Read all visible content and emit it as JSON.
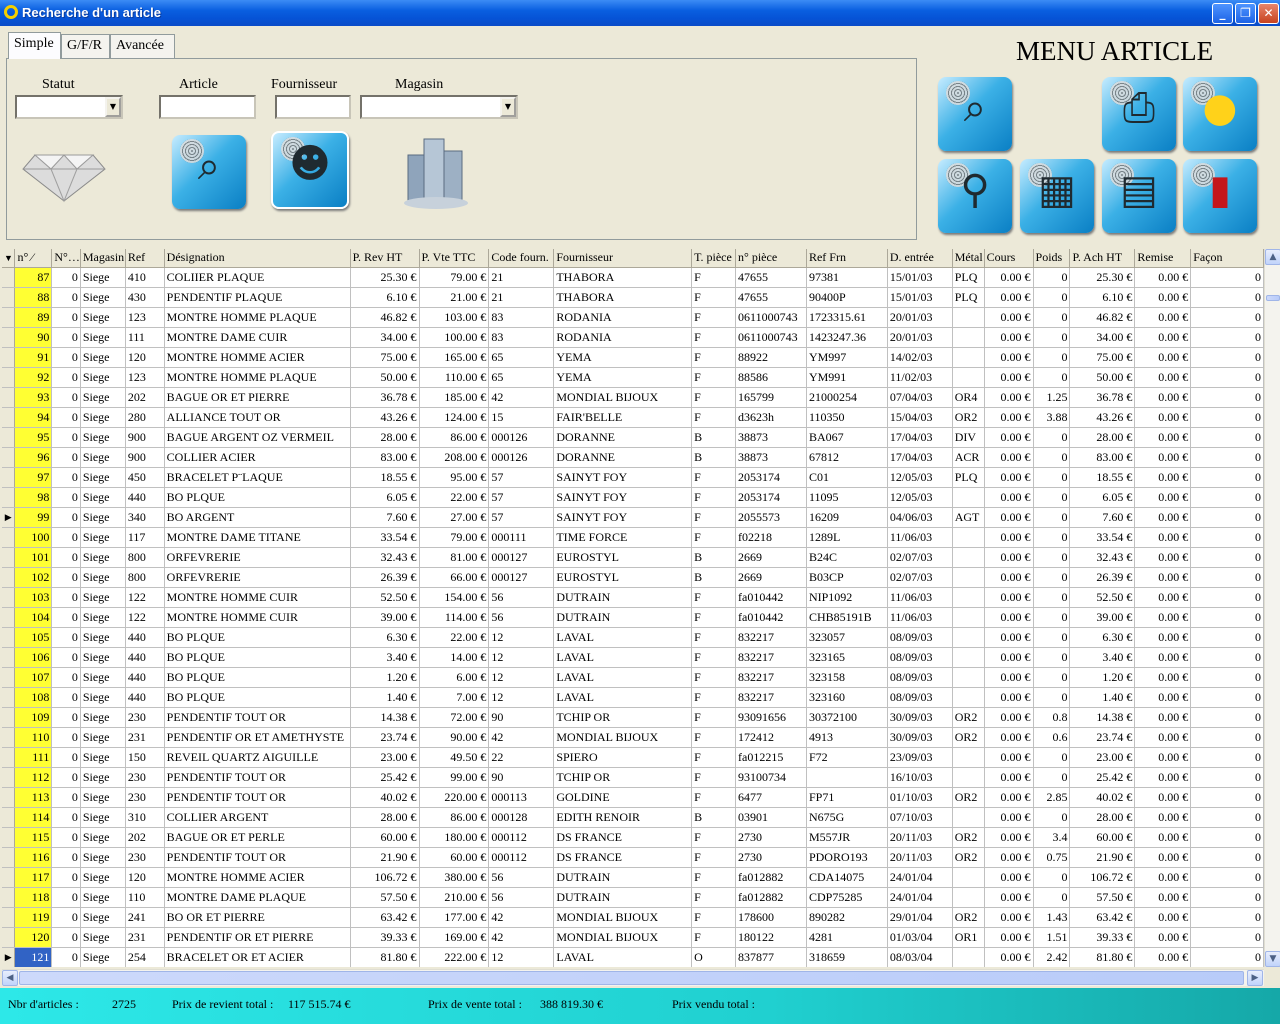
{
  "window": {
    "title": "Recherche d'un article"
  },
  "tabs": [
    "Simple",
    "G/F/R",
    "Avancée"
  ],
  "filters": {
    "statut_label": "Statut",
    "article_label": "Article",
    "fournisseur_label": "Fournisseur",
    "magasin_label": "Magasin",
    "statut_value": "",
    "article_value": "",
    "fournisseur_value": "",
    "magasin_value": ""
  },
  "menu": {
    "title": "MENU ARTICLE"
  },
  "icons": {
    "search": "binoculars-icon",
    "search_person": "person-binoculars-icon",
    "buildings": "buildings-icon",
    "diamond": "diamond-icon",
    "print": "printer-icon",
    "idea": "lightbulb-icon",
    "zoom": "magnifier-icon",
    "trash": "trash-icon",
    "calculator": "calculator-icon",
    "exit": "door-icon"
  },
  "grid": {
    "columns": [
      "n° ⁄",
      "N°…",
      "Magasin",
      "Ref",
      "Désignation",
      "P. Rev HT",
      "P. Vte TTC",
      "Code fourn.",
      "Fournisseur",
      "T. pièce",
      "n° pièce",
      "Ref Frn",
      "D. entrée",
      "Métal",
      "Cours",
      "Poids",
      "P. Ach HT",
      "Remise",
      "Façon"
    ],
    "rows": [
      [
        "87",
        "0",
        "Siege",
        "410",
        "COLIIER PLAQUE",
        "25.30 €",
        "79.00 €",
        "21",
        "THABORA",
        "F",
        "47655",
        "97381",
        "15/01/03",
        "PLQ",
        "0.00 €",
        "0",
        "25.30 €",
        "0.00 €",
        "0"
      ],
      [
        "88",
        "0",
        "Siege",
        "430",
        "PENDENTIF PLAQUE",
        "6.10 €",
        "21.00 €",
        "21",
        "THABORA",
        "F",
        "47655",
        "90400P",
        "15/01/03",
        "PLQ",
        "0.00 €",
        "0",
        "6.10 €",
        "0.00 €",
        "0"
      ],
      [
        "89",
        "0",
        "Siege",
        "123",
        "MONTRE HOMME PLAQUE",
        "46.82 €",
        "103.00 €",
        "83",
        "RODANIA",
        "F",
        "0611000743",
        "1723315.61",
        "20/01/03",
        "",
        "0.00 €",
        "0",
        "46.82 €",
        "0.00 €",
        "0"
      ],
      [
        "90",
        "0",
        "Siege",
        "111",
        "MONTRE DAME CUIR",
        "34.00 €",
        "100.00 €",
        "83",
        "RODANIA",
        "F",
        "0611000743",
        "1423247.36",
        "20/01/03",
        "",
        "0.00 €",
        "0",
        "34.00 €",
        "0.00 €",
        "0"
      ],
      [
        "91",
        "0",
        "Siege",
        "120",
        "MONTRE HOMME ACIER",
        "75.00 €",
        "165.00 €",
        "65",
        "YEMA",
        "F",
        "88922",
        "YM997",
        "14/02/03",
        "",
        "0.00 €",
        "0",
        "75.00 €",
        "0.00 €",
        "0"
      ],
      [
        "92",
        "0",
        "Siege",
        "123",
        "MONTRE HOMME PLAQUE",
        "50.00 €",
        "110.00 €",
        "65",
        "YEMA",
        "F",
        "88586",
        "YM991",
        "11/02/03",
        "",
        "0.00 €",
        "0",
        "50.00 €",
        "0.00 €",
        "0"
      ],
      [
        "93",
        "0",
        "Siege",
        "202",
        "BAGUE OR ET PIERRE",
        "36.78 €",
        "185.00 €",
        "42",
        "MONDIAL BIJOUX",
        "F",
        "165799",
        "21000254",
        "07/04/03",
        "OR4",
        "0.00 €",
        "1.25",
        "36.78 €",
        "0.00 €",
        "0"
      ],
      [
        "94",
        "0",
        "Siege",
        "280",
        "ALLIANCE TOUT OR",
        "43.26 €",
        "124.00 €",
        "15",
        "FAIR'BELLE",
        "F",
        "d3623h",
        "110350",
        "15/04/03",
        "OR2",
        "0.00 €",
        "3.88",
        "43.26 €",
        "0.00 €",
        "0"
      ],
      [
        "95",
        "0",
        "Siege",
        "900",
        "BAGUE ARGENT OZ VERMEIL",
        "28.00 €",
        "86.00 €",
        "000126",
        "DORANNE",
        "B",
        "38873",
        "BA067",
        "17/04/03",
        "DIV",
        "0.00 €",
        "0",
        "28.00 €",
        "0.00 €",
        "0"
      ],
      [
        "96",
        "0",
        "Siege",
        "900",
        "COLLIER ACIER",
        "83.00 €",
        "208.00 €",
        "000126",
        "DORANNE",
        "B",
        "38873",
        "67812",
        "17/04/03",
        "ACR",
        "0.00 €",
        "0",
        "83.00 €",
        "0.00 €",
        "0"
      ],
      [
        "97",
        "0",
        "Siege",
        "450",
        "BRACELET P¨LAQUE",
        "18.55 €",
        "95.00 €",
        "57",
        "SAINYT FOY",
        "F",
        "2053174",
        "C01",
        "12/05/03",
        "PLQ",
        "0.00 €",
        "0",
        "18.55 €",
        "0.00 €",
        "0"
      ],
      [
        "98",
        "0",
        "Siege",
        "440",
        "BO PLQUE",
        "6.05 €",
        "22.00 €",
        "57",
        "SAINYT FOY",
        "F",
        "2053174",
        "11095",
        "12/05/03",
        "",
        "0.00 €",
        "0",
        "6.05 €",
        "0.00 €",
        "0"
      ],
      [
        "99",
        "0",
        "Siege",
        "340",
        "BO ARGENT",
        "7.60 €",
        "27.00 €",
        "57",
        "SAINYT FOY",
        "F",
        "2055573",
        "16209",
        "04/06/03",
        "AGT",
        "0.00 €",
        "0",
        "7.60 €",
        "0.00 €",
        "0"
      ],
      [
        "100",
        "0",
        "Siege",
        "117",
        "MONTRE DAME TITANE",
        "33.54 €",
        "79.00 €",
        "000111",
        "TIME FORCE",
        "F",
        "f02218",
        "1289L",
        "11/06/03",
        "",
        "0.00 €",
        "0",
        "33.54 €",
        "0.00 €",
        "0"
      ],
      [
        "101",
        "0",
        "Siege",
        "800",
        "ORFEVRERIE",
        "32.43 €",
        "81.00 €",
        "000127",
        "EUROSTYL",
        "B",
        "2669",
        "B24C",
        "02/07/03",
        "",
        "0.00 €",
        "0",
        "32.43 €",
        "0.00 €",
        "0"
      ],
      [
        "102",
        "0",
        "Siege",
        "800",
        "ORFEVRERIE",
        "26.39 €",
        "66.00 €",
        "000127",
        "EUROSTYL",
        "B",
        "2669",
        "B03CP",
        "02/07/03",
        "",
        "0.00 €",
        "0",
        "26.39 €",
        "0.00 €",
        "0"
      ],
      [
        "103",
        "0",
        "Siege",
        "122",
        "MONTRE HOMME CUIR",
        "52.50 €",
        "154.00 €",
        "56",
        "DUTRAIN",
        "F",
        "fa010442",
        "NIP1092",
        "11/06/03",
        "",
        "0.00 €",
        "0",
        "52.50 €",
        "0.00 €",
        "0"
      ],
      [
        "104",
        "0",
        "Siege",
        "122",
        "MONTRE HOMME CUIR",
        "39.00 €",
        "114.00 €",
        "56",
        "DUTRAIN",
        "F",
        "fa010442",
        "CHB85191B",
        "11/06/03",
        "",
        "0.00 €",
        "0",
        "39.00 €",
        "0.00 €",
        "0"
      ],
      [
        "105",
        "0",
        "Siege",
        "440",
        "BO PLQUE",
        "6.30 €",
        "22.00 €",
        "12",
        "LAVAL",
        "F",
        "832217",
        "323057",
        "08/09/03",
        "",
        "0.00 €",
        "0",
        "6.30 €",
        "0.00 €",
        "0"
      ],
      [
        "106",
        "0",
        "Siege",
        "440",
        "BO PLQUE",
        "3.40 €",
        "14.00 €",
        "12",
        "LAVAL",
        "F",
        "832217",
        "323165",
        "08/09/03",
        "",
        "0.00 €",
        "0",
        "3.40 €",
        "0.00 €",
        "0"
      ],
      [
        "107",
        "0",
        "Siege",
        "440",
        "BO PLQUE",
        "1.20 €",
        "6.00 €",
        "12",
        "LAVAL",
        "F",
        "832217",
        "323158",
        "08/09/03",
        "",
        "0.00 €",
        "0",
        "1.20 €",
        "0.00 €",
        "0"
      ],
      [
        "108",
        "0",
        "Siege",
        "440",
        "BO PLQUE",
        "1.40 €",
        "7.00 €",
        "12",
        "LAVAL",
        "F",
        "832217",
        "323160",
        "08/09/03",
        "",
        "0.00 €",
        "0",
        "1.40 €",
        "0.00 €",
        "0"
      ],
      [
        "109",
        "0",
        "Siege",
        "230",
        "PENDENTIF  TOUT OR",
        "14.38 €",
        "72.00 €",
        "90",
        "TCHIP OR",
        "F",
        "93091656",
        "30372100",
        "30/09/03",
        "OR2",
        "0.00 €",
        "0.8",
        "14.38 €",
        "0.00 €",
        "0"
      ],
      [
        "110",
        "0",
        "Siege",
        "231",
        "PENDENTIF OR ET AMETHYSTE",
        "23.74 €",
        "90.00 €",
        "42",
        "MONDIAL BIJOUX",
        "F",
        "172412",
        "4913",
        "30/09/03",
        "OR2",
        "0.00 €",
        "0.6",
        "23.74 €",
        "0.00 €",
        "0"
      ],
      [
        "111",
        "0",
        "Siege",
        "150",
        "REVEIL QUARTZ AIGUILLE",
        "23.00 €",
        "49.50 €",
        "22",
        "SPIERO",
        "F",
        "fa012215",
        "F72",
        "23/09/03",
        "",
        "0.00 €",
        "0",
        "23.00 €",
        "0.00 €",
        "0"
      ],
      [
        "112",
        "0",
        "Siege",
        "230",
        "PENDENTIF  TOUT OR",
        "25.42 €",
        "99.00 €",
        "90",
        "TCHIP OR",
        "F",
        "93100734",
        "",
        "16/10/03",
        "",
        "0.00 €",
        "0",
        "25.42 €",
        "0.00 €",
        "0"
      ],
      [
        "113",
        "0",
        "Siege",
        "230",
        "PENDENTIF  TOUT OR",
        "40.02 €",
        "220.00 €",
        "000113",
        "GOLDINE",
        "F",
        "6477",
        "FP71",
        "01/10/03",
        "OR2",
        "0.00 €",
        "2.85",
        "40.02 €",
        "0.00 €",
        "0"
      ],
      [
        "114",
        "0",
        "Siege",
        "310",
        "COLLIER ARGENT",
        "28.00 €",
        "86.00 €",
        "000128",
        "EDITH RENOIR",
        "B",
        "03901",
        "N675G",
        "07/10/03",
        "",
        "0.00 €",
        "0",
        "28.00 €",
        "0.00 €",
        "0"
      ],
      [
        "115",
        "0",
        "Siege",
        "202",
        "BAGUE OR ET PERLE",
        "60.00 €",
        "180.00 €",
        "000112",
        "DS FRANCE",
        "F",
        "2730",
        "M557JR",
        "20/11/03",
        "OR2",
        "0.00 €",
        "3.4",
        "60.00 €",
        "0.00 €",
        "0"
      ],
      [
        "116",
        "0",
        "Siege",
        "230",
        "PENDENTIF  TOUT OR",
        "21.90 €",
        "60.00 €",
        "000112",
        "DS FRANCE",
        "F",
        "2730",
        "PDORO193",
        "20/11/03",
        "OR2",
        "0.00 €",
        "0.75",
        "21.90 €",
        "0.00 €",
        "0"
      ],
      [
        "117",
        "0",
        "Siege",
        "120",
        "MONTRE HOMME ACIER",
        "106.72 €",
        "380.00 €",
        "56",
        "DUTRAIN",
        "F",
        "fa012882",
        "CDA14075",
        "24/01/04",
        "",
        "0.00 €",
        "0",
        "106.72 €",
        "0.00 €",
        "0"
      ],
      [
        "118",
        "0",
        "Siege",
        "110",
        "MONTRE DAME PLAQUE",
        "57.50 €",
        "210.00 €",
        "56",
        "DUTRAIN",
        "F",
        "fa012882",
        "CDP75285",
        "24/01/04",
        "",
        "0.00 €",
        "0",
        "57.50 €",
        "0.00 €",
        "0"
      ],
      [
        "119",
        "0",
        "Siege",
        "241",
        "BO OR ET PIERRE",
        "63.42 €",
        "177.00 €",
        "42",
        "MONDIAL BIJOUX",
        "F",
        "178600",
        "890282",
        "29/01/04",
        "OR2",
        "0.00 €",
        "1.43",
        "63.42 €",
        "0.00 €",
        "0"
      ],
      [
        "120",
        "0",
        "Siege",
        "231",
        "PENDENTIF OR ET PIERRE",
        "39.33 €",
        "169.00 €",
        "42",
        "MONDIAL BIJOUX",
        "F",
        "180122",
        "4281",
        "01/03/04",
        "OR1",
        "0.00 €",
        "1.51",
        "39.33 €",
        "0.00 €",
        "0"
      ],
      [
        "121",
        "0",
        "Siege",
        "254",
        "BRACELET OR ET ACIER",
        "81.80 €",
        "222.00 €",
        "12",
        "LAVAL",
        "O",
        "837877",
        "318659",
        "08/03/04",
        "",
        "0.00 €",
        "2.42",
        "81.80 €",
        "0.00 €",
        "0"
      ]
    ]
  },
  "status": {
    "nbr_label": "Nbr d'articles :",
    "nbr_value": "2725",
    "prix_revient_label": "Prix de revient total :",
    "prix_revient_value": "117 515.74 €",
    "prix_vente_label": "Prix de vente total :",
    "prix_vente_value": "388 819.30 €",
    "prix_vendu_label": "Prix vendu total :"
  }
}
